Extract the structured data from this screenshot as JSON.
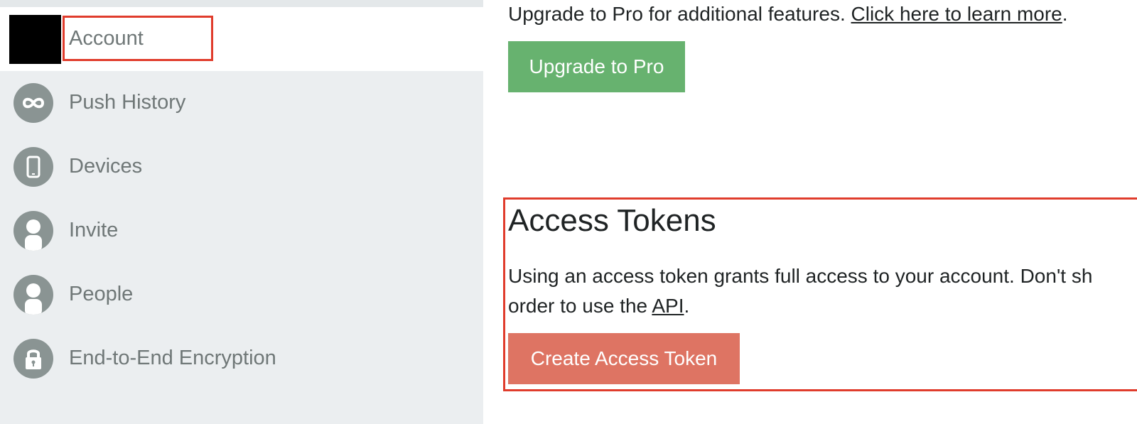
{
  "colors": {
    "sidebar_bg": "#ebeef0",
    "active_item_bg": "#ffffff",
    "icon_circle": "#8a9493",
    "highlight_border": "#e03c2c",
    "upgrade_button": "#67b26f",
    "create_token_button": "#de7463"
  },
  "sidebar": {
    "items": [
      {
        "label": "Account",
        "icon": "account-avatar"
      },
      {
        "label": "Push History",
        "icon": "infinity-icon"
      },
      {
        "label": "Devices",
        "icon": "phone-icon"
      },
      {
        "label": "Invite",
        "icon": "person-icon"
      },
      {
        "label": "People",
        "icon": "person-icon"
      },
      {
        "label": "End-to-End Encryption",
        "icon": "lock-icon"
      }
    ]
  },
  "main": {
    "upgrade": {
      "text": "Upgrade to Pro for additional features.",
      "link": "Click here to learn more",
      "period": ".",
      "button": "Upgrade to Pro"
    },
    "access_tokens": {
      "title": "Access Tokens",
      "description_line1": "Using an access token grants full access to your account. Don't sh",
      "description_line2_prefix": "order to use the",
      "api_link": "API",
      "description_line2_suffix": ".",
      "button": "Create Access Token"
    }
  }
}
